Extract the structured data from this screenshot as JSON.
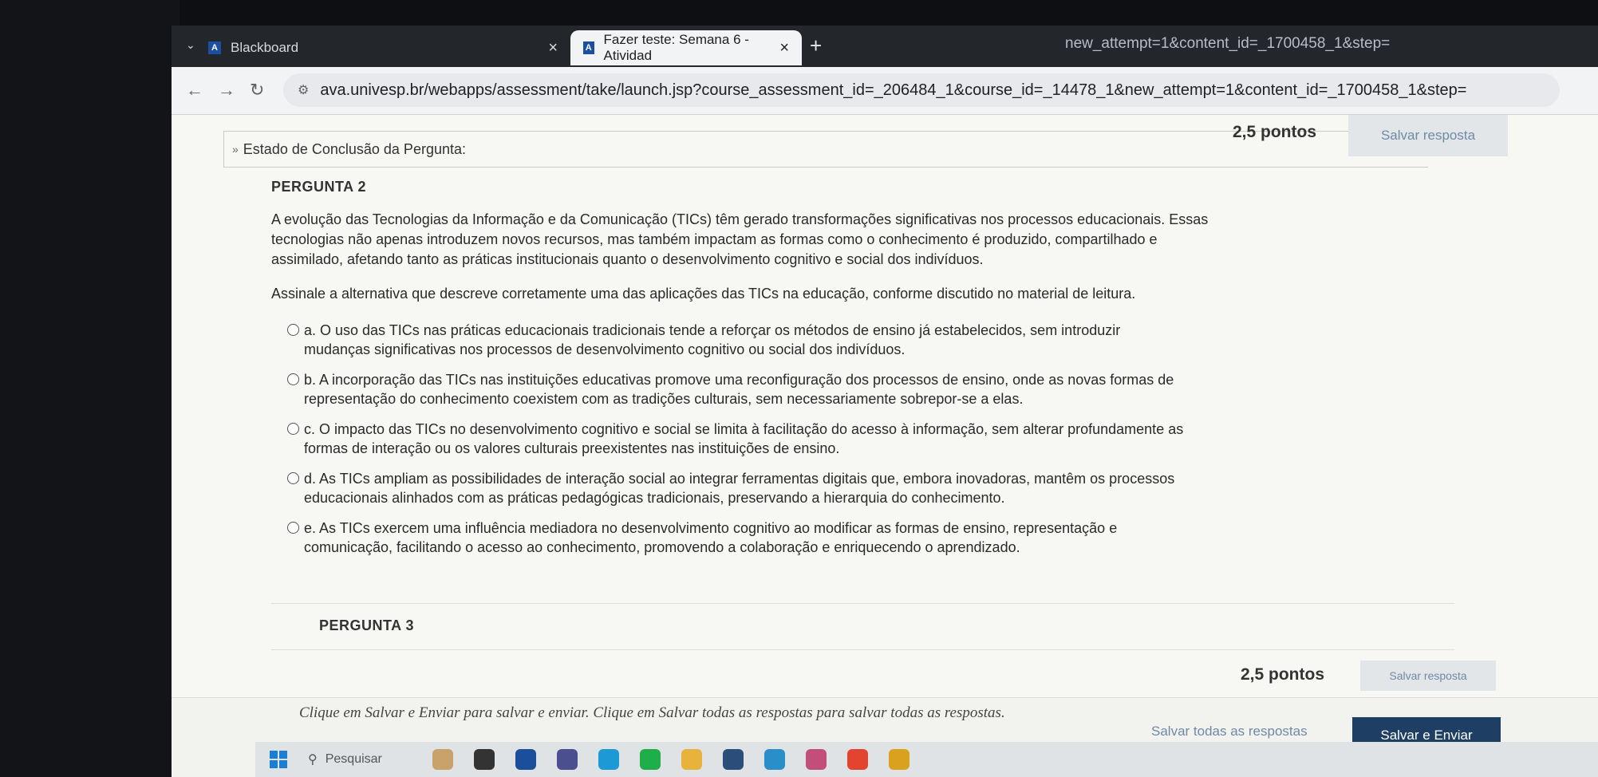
{
  "browser": {
    "tabs": [
      {
        "title": "Blackboard"
      },
      {
        "title": "Fazer teste: Semana 6 - Atividad"
      }
    ],
    "url": "ava.univesp.br/webapps/assessment/take/launch.jsp?course_assessment_id=_206484_1&course_id=_14478_1&new_attempt=1&content_id=_1700458_1&step=",
    "url_overflow": "new_attempt=1&content_id=_1700458_1&step="
  },
  "status": {
    "label": "Estado de Conclusão da Pergunta:"
  },
  "question2": {
    "title": "PERGUNTA 2",
    "points": "2,5 pontos",
    "save_label": "Salvar resposta",
    "body": "A evolução das Tecnologias da Informação e da Comunicação (TICs) têm gerado transformações significativas nos processos educacionais. Essas tecnologias não apenas introduzem novos recursos, mas também impactam as formas como o conhecimento é produzido, compartilhado e assimilado, afetando tanto as práticas institucionais quanto o desenvolvimento cognitivo e social dos indivíduos.",
    "prompt": "Assinale a alternativa que descreve corretamente uma das aplicações das TICs na educação, conforme discutido no material de leitura.",
    "options": [
      {
        "text": "a. O uso das TICs nas práticas educacionais tradicionais tende a reforçar os métodos de ensino já estabelecidos, sem introduzir mudanças significativas nos processos de desenvolvimento cognitivo ou social dos indivíduos."
      },
      {
        "text": "b. A incorporação das TICs nas instituições educativas promove uma reconfiguração dos processos de ensino, onde as novas formas de representação do conhecimento coexistem com as tradições culturais, sem necessariamente sobrepor-se a elas."
      },
      {
        "text": "c. O impacto das TICs no desenvolvimento cognitivo e social se limita à facilitação do acesso à informação, sem alterar profundamente as formas de interação ou os valores culturais preexistentes nas instituições de ensino."
      },
      {
        "text": "d. As TICs ampliam as possibilidades de interação social ao integrar ferramentas digitais que, embora inovadoras, mantêm os processos educacionais alinhados com as práticas pedagógicas tradicionais, preservando a hierarquia do conhecimento."
      },
      {
        "text": "e. As TICs exercem uma influência mediadora no desenvolvimento cognitivo ao modificar as formas de ensino, representação e comunicação, facilitando o acesso ao conhecimento, promovendo a colaboração e enriquecendo o aprendizado."
      }
    ]
  },
  "question3": {
    "title": "PERGUNTA 3",
    "points": "2,5 pontos",
    "save_label": "Salvar resposta"
  },
  "footer": {
    "instructions": "Clique em Salvar e Enviar para salvar e enviar. Clique em Salvar todas as respostas para salvar todas as respostas.",
    "save_all_label": "Salvar todas as respostas",
    "submit_label": "Salvar e Enviar"
  },
  "taskbar": {
    "search_placeholder": "Pesquisar"
  }
}
